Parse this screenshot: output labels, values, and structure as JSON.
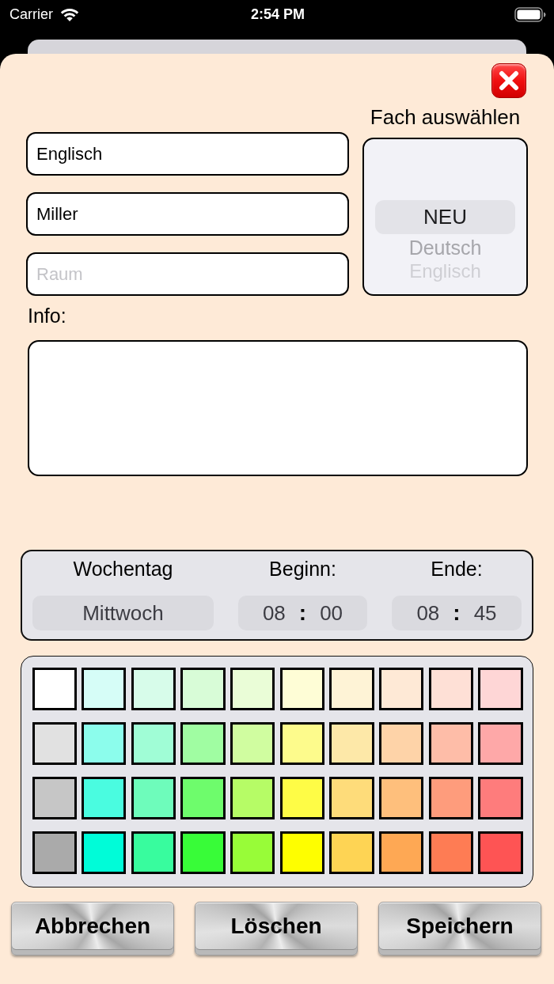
{
  "status_bar": {
    "carrier": "Carrier",
    "time": "2:54 PM"
  },
  "fields": [
    {
      "value": "Englisch"
    },
    {
      "value": "Miller"
    },
    {
      "placeholder": "Raum"
    }
  ],
  "subject_picker": {
    "title": "Fach auswählen",
    "options": [
      {
        "label": "NEU",
        "selected": true
      },
      {
        "label": "Deutsch",
        "selected": false
      },
      {
        "label": "Englisch",
        "selected": false
      }
    ]
  },
  "info": {
    "label": "Info:"
  },
  "schedule": [
    {
      "kind": "day",
      "label": "Wochentag",
      "value": "Mittwoch"
    },
    {
      "kind": "time",
      "label": "Beginn:",
      "hour": "08",
      "separator": ":",
      "minute": "00"
    },
    {
      "kind": "time",
      "label": "Ende:",
      "hour": "08",
      "separator": ":",
      "minute": "45"
    }
  ],
  "palette": {
    "rows": [
      {
        "swatches": [
          {
            "color": "#ffffff"
          },
          {
            "color": "#d6fdf7"
          },
          {
            "color": "#d7fcea"
          },
          {
            "color": "#d8fcd7"
          },
          {
            "color": "#eafdd7"
          },
          {
            "color": "#fefdd6"
          },
          {
            "color": "#fef3d6"
          },
          {
            "color": "#fee9d6"
          },
          {
            "color": "#fee0d6"
          },
          {
            "color": "#fed6d6"
          }
        ]
      },
      {
        "swatches": [
          {
            "color": "#e1e1e1"
          },
          {
            "color": "#8cfdec"
          },
          {
            "color": "#a0fdd6"
          },
          {
            "color": "#a0fda2"
          },
          {
            "color": "#d0fda0"
          },
          {
            "color": "#fdfb8c"
          },
          {
            "color": "#fde8a8"
          },
          {
            "color": "#fed3a8"
          },
          {
            "color": "#febda8"
          },
          {
            "color": "#fea8a8"
          }
        ]
      },
      {
        "swatches": [
          {
            "color": "#c6c6c6"
          },
          {
            "color": "#4afce0"
          },
          {
            "color": "#6efcbb"
          },
          {
            "color": "#6efc6c"
          },
          {
            "color": "#b6fc66"
          },
          {
            "color": "#fefc46"
          },
          {
            "color": "#fedc7a"
          },
          {
            "color": "#febf7c"
          },
          {
            "color": "#fe9c7c"
          },
          {
            "color": "#fe7c7c"
          }
        ]
      },
      {
        "swatches": [
          {
            "color": "#aaaaaa"
          },
          {
            "color": "#00fcd8"
          },
          {
            "color": "#38fc9e"
          },
          {
            "color": "#38fc38"
          },
          {
            "color": "#98fc38"
          },
          {
            "color": "#fefe00"
          },
          {
            "color": "#fed454"
          },
          {
            "color": "#fea854"
          },
          {
            "color": "#fe7c54"
          },
          {
            "color": "#fe5454"
          }
        ]
      }
    ]
  },
  "buttons": [
    "Abbrechen",
    "Löschen",
    "Speichern"
  ]
}
